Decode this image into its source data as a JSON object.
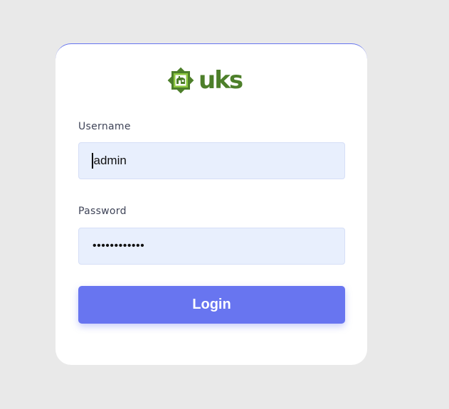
{
  "logo": {
    "text": "uks",
    "icon": "uks-emblem-icon",
    "brand_color": "#4d7f2a",
    "accent_color": "#8cc63f"
  },
  "form": {
    "username_label": "Username",
    "username_value": "admin",
    "password_label": "Password",
    "password_masked": "••••••••••••",
    "login_label": "Login"
  },
  "colors": {
    "page_background": "#e9e9e9",
    "card_background": "#ffffff",
    "input_background": "#e8effd",
    "button_background": "#6875f0",
    "card_top_border": "#6574f0"
  }
}
